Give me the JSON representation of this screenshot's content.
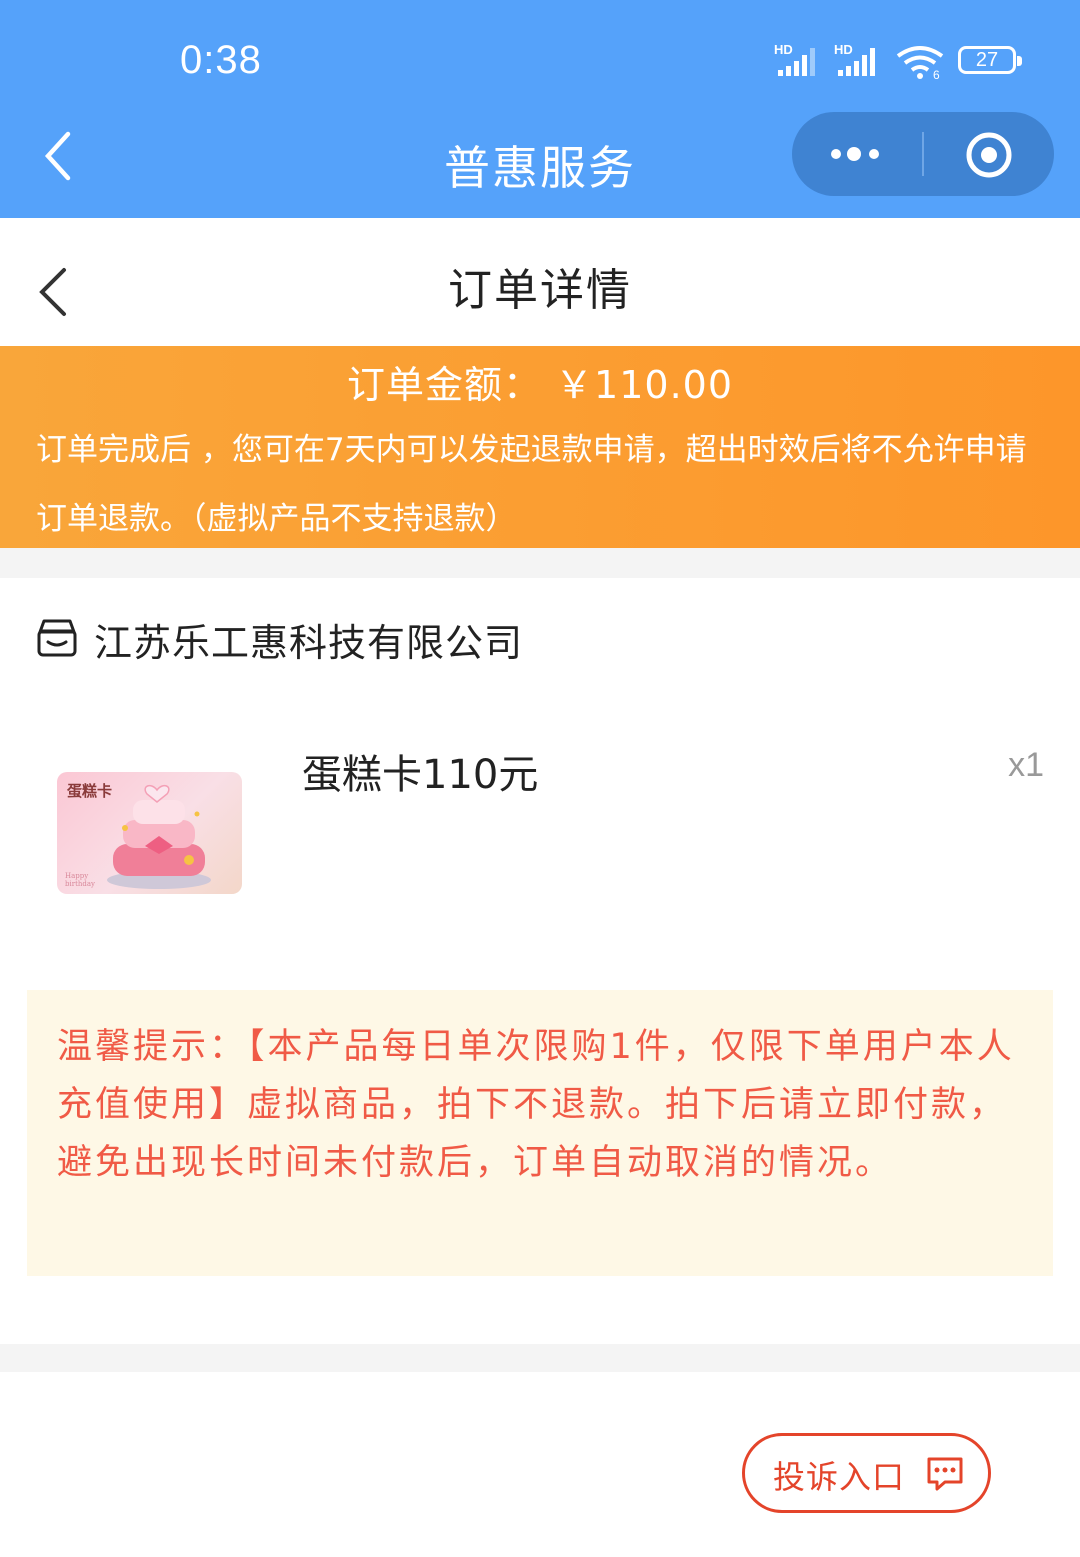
{
  "status_bar": {
    "time": "0:38",
    "signal1": "HD",
    "signal2": "HD",
    "wifi_sub": "6",
    "battery": "27"
  },
  "navbar": {
    "title": "普惠服务"
  },
  "page": {
    "title": "订单详情"
  },
  "banner": {
    "amount": "订单金额： ￥110.00",
    "notice": "订单完成后 ，您可在7天内可以发起退款申请，超出时效后将不允许申请订单退款。（虚拟产品不支持退款）"
  },
  "shop": {
    "name": "江苏乐工惠科技有限公司",
    "icon": "store-icon"
  },
  "product": {
    "name": "蛋糕卡110元",
    "quantity": "x1",
    "image_text": "蛋糕卡",
    "image_subtext_1": "Happy",
    "image_subtext_2": "birthday"
  },
  "tips": {
    "text": "温馨提示：【本产品每日单次限购1件，仅限下单用户本人充值使用】虚拟商品，拍下不退款。拍下后请立即付款，避免出现长时间未付款后，订单自动取消的情况。"
  },
  "complain": {
    "label": "投诉入口",
    "icon": "message-icon"
  },
  "colors": {
    "nav_blue": "#55a2fa",
    "banner_orange": "#fd962a",
    "tip_text": "#f05a46",
    "tip_bg": "#fef8e6",
    "complain_red": "#e4442a"
  }
}
